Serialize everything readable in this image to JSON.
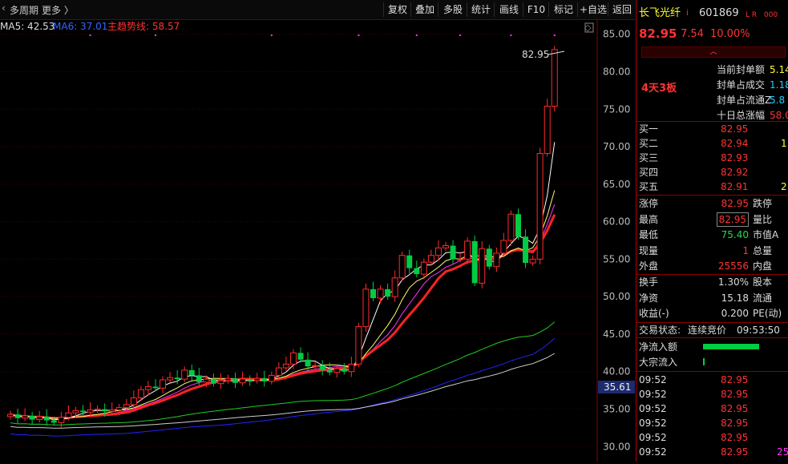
{
  "topbar": {
    "left": [
      "多周期",
      "更多 〉"
    ],
    "buttons": [
      "复权",
      "叠加",
      "多股",
      "统计",
      "画线",
      "F10",
      "标记",
      "+自选",
      "返回"
    ]
  },
  "indicators": {
    "ma5": "MA5: 42.53",
    "ma6": "MA6: 37.01",
    "trend": "主趋势线: 58.57"
  },
  "axis": {
    "ticks": [
      "85.00",
      "80.00",
      "75.00",
      "70.00",
      "65.00",
      "60.00",
      "55.00",
      "50.00",
      "45.00",
      "40.00",
      "35.00",
      "30.00"
    ],
    "highlight": "35.61"
  },
  "chart": {
    "peak_label": "82.95",
    "colors": {
      "up": "#ff2a2a",
      "down": "#00cc44",
      "ma_white": "#ffffff",
      "ma_yellow": "#ffff66",
      "ma_magenta": "#ff33ff",
      "ma_green": "#22cc22",
      "ma_gray": "#cccccc",
      "ma_blue": "#2222ff",
      "trend": "#ff2222"
    },
    "chart_data": {
      "type": "candlestick",
      "ylim": [
        28,
        87
      ],
      "closes": [
        34.3,
        33.8,
        34.1,
        33.6,
        34.0,
        33.5,
        33.2,
        33.9,
        34.5,
        34.8,
        34.6,
        34.9,
        35.0,
        34.7,
        34.9,
        35.2,
        35.6,
        36.5,
        37.6,
        38.0,
        37.8,
        38.9,
        39.2,
        39.0,
        40.2,
        39.5,
        38.6,
        39.0,
        38.4,
        38.8,
        39.1,
        38.5,
        39.0,
        38.8,
        39.1,
        38.7,
        39.5,
        40.5,
        41.0,
        42.5,
        41.6,
        40.7,
        40.8,
        40.2,
        39.9,
        40.4,
        40.0,
        41.0,
        46.0,
        51.0,
        49.8,
        51.0,
        50.0,
        52.5,
        55.5,
        53.8,
        53.0,
        54.6,
        55.5,
        56.5,
        56.8,
        55.0,
        55.0,
        57.4,
        51.8,
        56.4,
        54.0,
        55.8,
        57.5,
        61.0,
        58.0,
        54.5,
        55.0,
        69.1,
        75.4,
        82.95
      ]
    }
  },
  "stock": {
    "name": "长飞光纤",
    "name_suffix": "i",
    "code": "601869",
    "tag": "L R",
    "tag_suffix": "000",
    "price": "82.95",
    "change": "7.54",
    "pct": "10.00%"
  },
  "board": {
    "badge": "4天3板",
    "rows": [
      {
        "label": "当前封单额",
        "value": "5.14",
        "color": "#ffff33"
      },
      {
        "label": "封单占成交",
        "value": "1.18",
        "color": "#22ccff"
      },
      {
        "label": "封单占流通Z",
        "value": "5.8",
        "color": "#22ccff"
      },
      {
        "label": "十日总涨幅",
        "value": "58.0",
        "color": "#ff3333"
      }
    ]
  },
  "bids": [
    {
      "label": "买一",
      "price": "82.95",
      "vol": ""
    },
    {
      "label": "买二",
      "price": "82.94",
      "vol": "1"
    },
    {
      "label": "买三",
      "price": "82.93",
      "vol": ""
    },
    {
      "label": "买四",
      "price": "82.92",
      "vol": ""
    },
    {
      "label": "买五",
      "price": "82.91",
      "vol": "2"
    }
  ],
  "stats": [
    {
      "k1": "涨停",
      "v1": "82.95",
      "c1": "#ff3333",
      "k2": "跌停"
    },
    {
      "k1": "最高",
      "v1": "82.95",
      "c1": "#ff3333",
      "k2": "量比",
      "boxed": true
    },
    {
      "k1": "最低",
      "v1": "75.40",
      "c1": "#22dd44",
      "k2": "市值A"
    },
    {
      "k1": "现量",
      "v1": "1",
      "c1": "#ff3333",
      "k2": "总量"
    },
    {
      "k1": "外盘",
      "v1": "25556",
      "c1": "#ff3333",
      "k2": "内盘"
    },
    {
      "k1": "换手",
      "v1": "1.30%",
      "c1": "#dddddd",
      "k2": "股本"
    },
    {
      "k1": "净资",
      "v1": "15.18",
      "c1": "#dddddd",
      "k2": "流通"
    },
    {
      "k1": "收益(-)",
      "v1": "0.200",
      "c1": "#dddddd",
      "k2": "PE(动)"
    }
  ],
  "trade_status": {
    "label": "交易状态:",
    "value": "连续竞价",
    "time": "09:53:50"
  },
  "flow": [
    {
      "label": "净流入额"
    },
    {
      "label": "大宗流入"
    }
  ],
  "ticks": [
    {
      "time": "09:52",
      "price": "82.95",
      "vol": ""
    },
    {
      "time": "09:52",
      "price": "82.95",
      "vol": ""
    },
    {
      "time": "09:52",
      "price": "82.95",
      "vol": ""
    },
    {
      "time": "09:52",
      "price": "82.95",
      "vol": ""
    },
    {
      "time": "09:52",
      "price": "82.95",
      "vol": ""
    },
    {
      "time": "09:52",
      "price": "82.95",
      "vol": "25"
    }
  ]
}
